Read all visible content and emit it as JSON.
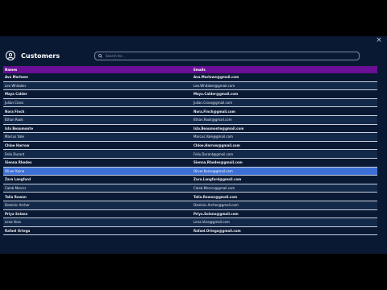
{
  "window": {
    "close_label": "×"
  },
  "header": {
    "title": "Customers"
  },
  "search": {
    "placeholder": "Search for..."
  },
  "table": {
    "columns": [
      "Names",
      "Emails"
    ],
    "rows": [
      [
        "Ava Marlowe",
        "Ava.Marlowe@gmail.com"
      ],
      [
        "Leo Whitaker",
        "Leo.Whitaker@gmail.com"
      ],
      [
        "Maya Calder",
        "Maya.Calder@gmail.com"
      ],
      [
        "Julian Cross",
        "Julian.Cross@gmail.com"
      ],
      [
        "Nora Finch",
        "Nora.Finch@gmail.com"
      ],
      [
        "Ethan Rook",
        "Ethan.Rook@gmail.com"
      ],
      [
        "Isla Beaumonte",
        "Isla.Beaumonte@gmail.com"
      ],
      [
        "Marcus Vale",
        "Marcus.Vale@gmail.com"
      ],
      [
        "Chloe Harrow",
        "Chloe.Harrow@gmail.com"
      ],
      [
        "Felix Durant",
        "Felix.Durant@gmail.com"
      ],
      [
        "Sienna Rhodes",
        "Sienna.Rhodes@gmail.com"
      ],
      [
        "Oliver Kaine",
        "Oliver.Kaine@gmail.com"
      ],
      [
        "Zara Langford",
        "Zara.Langford@gmail.com"
      ],
      [
        "Caleb Mercer",
        "Caleb.Mercer@gmail.com"
      ],
      [
        "Talia Rowan",
        "Talia.Rowan@gmail.com"
      ],
      [
        "Dominic Archer",
        "Dominic.Archer@gmail.com"
      ],
      [
        "Priya Solano",
        "Priya.Solano@gmail.com"
      ],
      [
        "Lena Voss",
        "Lena.Voss@gmail.com"
      ],
      [
        "Rafael Ortega",
        "Rafael.Ortega@gmail.com"
      ]
    ],
    "bold_rows": [
      0,
      2,
      4,
      6,
      8,
      10,
      12,
      14,
      16,
      18
    ],
    "selected_row": 11
  },
  "colors": {
    "background": "#0a1933",
    "header_row": "#6a0f96",
    "selected_row": "#3b6fd6"
  }
}
